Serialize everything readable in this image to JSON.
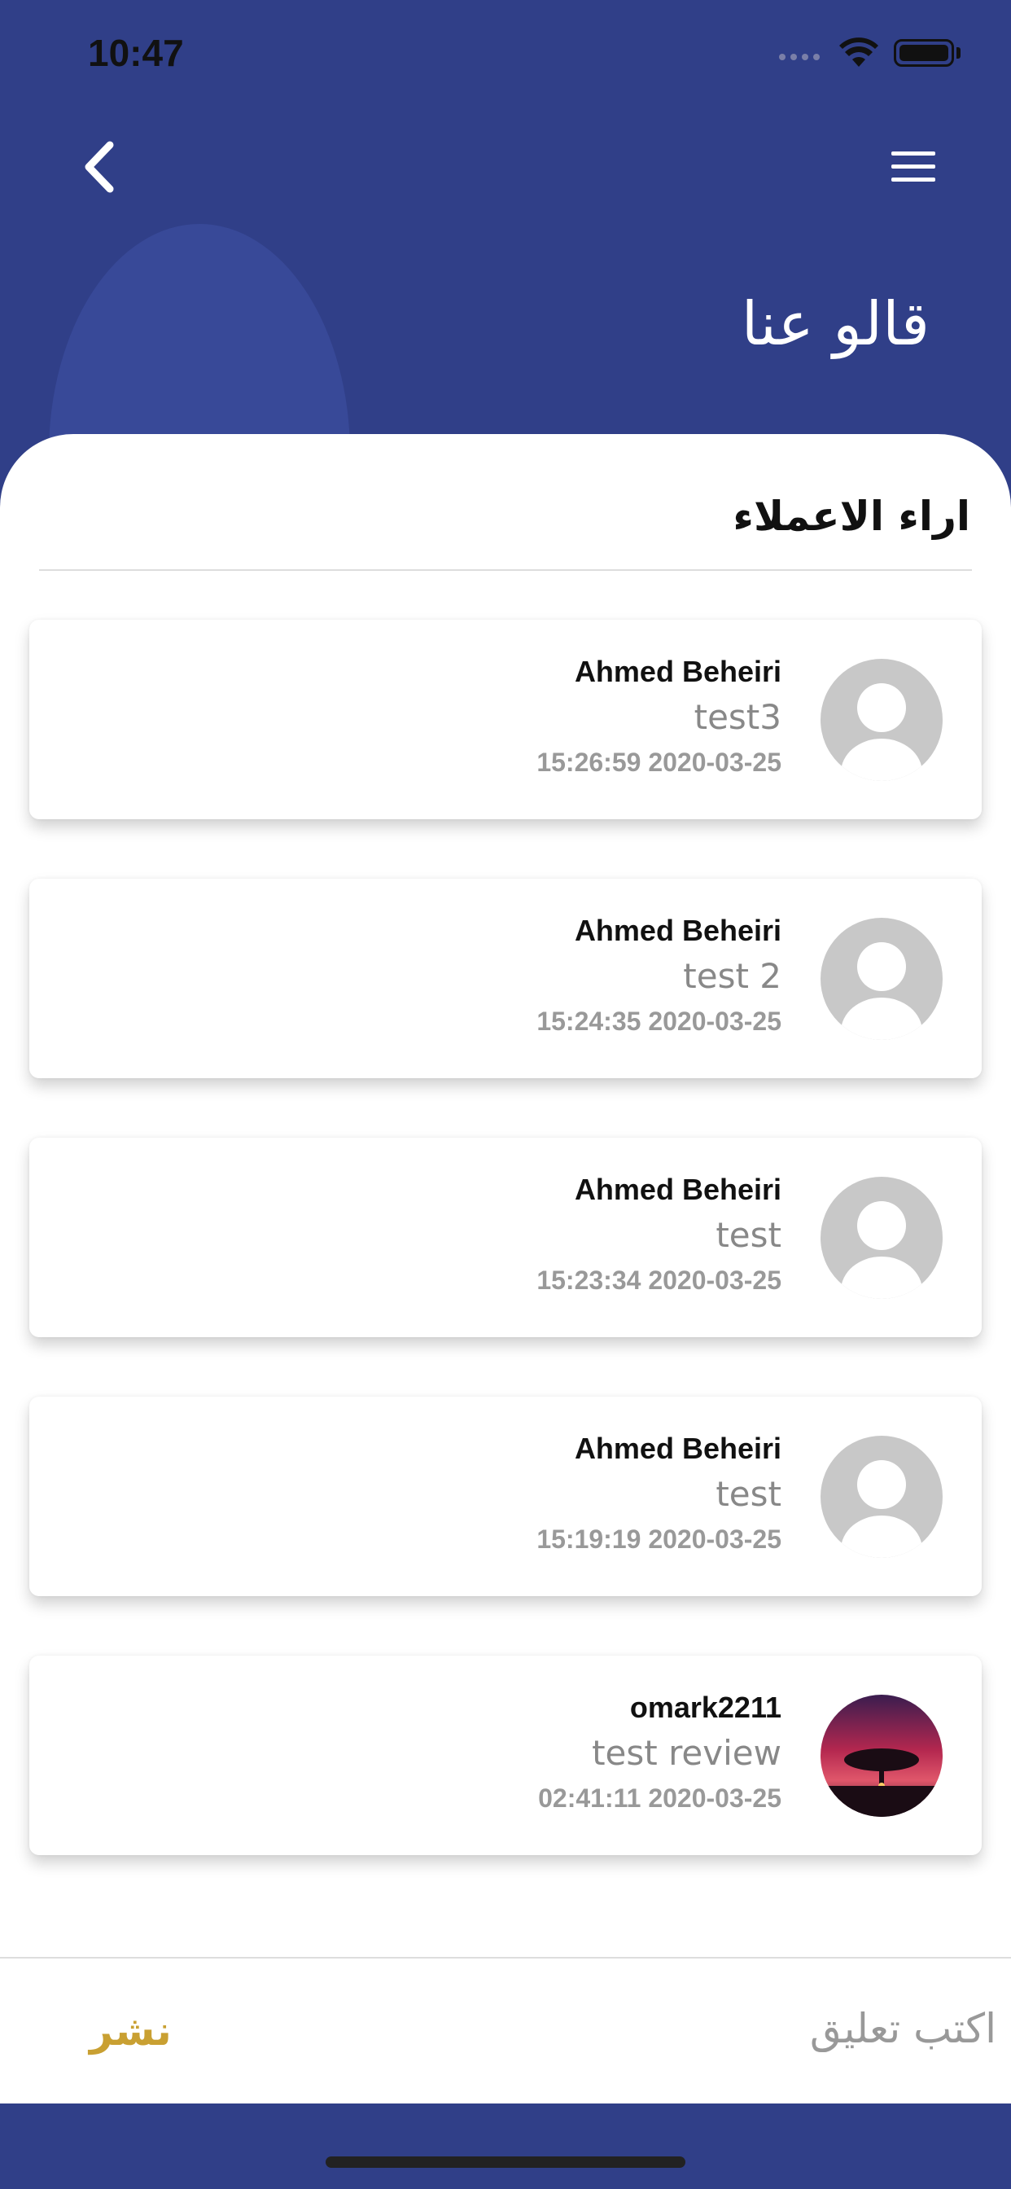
{
  "status_bar": {
    "time": "10:47"
  },
  "header": {
    "title": "قالو عنا"
  },
  "section": {
    "title": "اراء الاعملاء"
  },
  "reviews": [
    {
      "name": "Ahmed Beheiri",
      "comment": "test3",
      "date": "15:26:59 2020-03-25",
      "avatar": "default-avatar"
    },
    {
      "name": "Ahmed Beheiri",
      "comment": "test 2",
      "date": "15:24:35 2020-03-25",
      "avatar": "default-avatar"
    },
    {
      "name": "Ahmed Beheiri",
      "comment": "test",
      "date": "15:23:34 2020-03-25",
      "avatar": "default-avatar"
    },
    {
      "name": "Ahmed Beheiri",
      "comment": "test",
      "date": "15:19:19 2020-03-25",
      "avatar": "default-avatar"
    },
    {
      "name": "omark2211",
      "comment": "test review",
      "date": "02:41:11 2020-03-25",
      "avatar": "photo-avatar"
    }
  ],
  "comment_bar": {
    "placeholder": "اكتب تعليق",
    "publish_label": "نشر"
  },
  "colors": {
    "header_bg": "#303f88",
    "accent": "#c9a032",
    "card_bg": "#ffffff"
  }
}
